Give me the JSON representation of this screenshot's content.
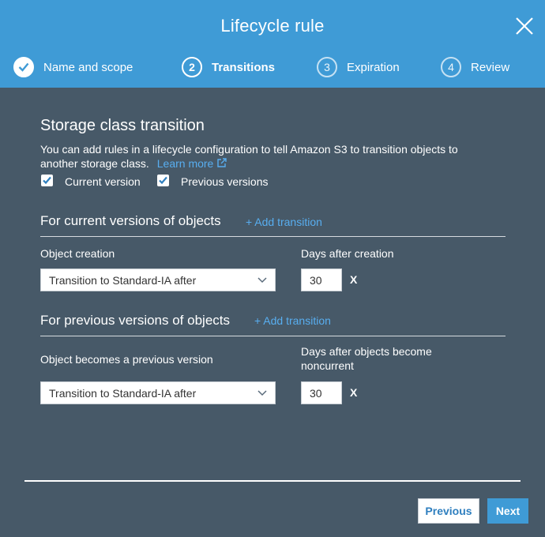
{
  "dialog": {
    "title": "Lifecycle rule",
    "close_icon": "close-icon"
  },
  "steps": [
    {
      "number": "1",
      "label": "Name and scope",
      "state": "done"
    },
    {
      "number": "2",
      "label": "Transitions",
      "state": "active"
    },
    {
      "number": "3",
      "label": "Expiration",
      "state": "inactive"
    },
    {
      "number": "4",
      "label": "Review",
      "state": "inactive"
    }
  ],
  "section": {
    "title": "Storage class transition",
    "description": "You can add rules in a lifecycle configuration to tell Amazon S3 to transition objects to another storage class.",
    "learn_more": "Learn more",
    "current_version_label": "Current version",
    "current_version_checked": true,
    "previous_versions_label": "Previous versions",
    "previous_versions_checked": true
  },
  "current": {
    "title": "For current versions of objects",
    "add_transition": "+ Add transition",
    "object_label": "Object creation",
    "days_label": "Days after creation",
    "select_value": "Transition to Standard-IA after",
    "days_value": "30",
    "x": "X"
  },
  "previous": {
    "title": "For previous versions of objects",
    "add_transition": "+ Add transition",
    "object_label": "Object becomes a previous version",
    "days_label": "Days after objects become noncurrent",
    "select_value": "Transition to Standard-IA after",
    "days_value": "30",
    "x": "X"
  },
  "footer": {
    "previous_label": "Previous",
    "next_label": "Next"
  },
  "colors": {
    "header": "#3f9bd6",
    "body": "#475968",
    "link": "#58aef0"
  }
}
